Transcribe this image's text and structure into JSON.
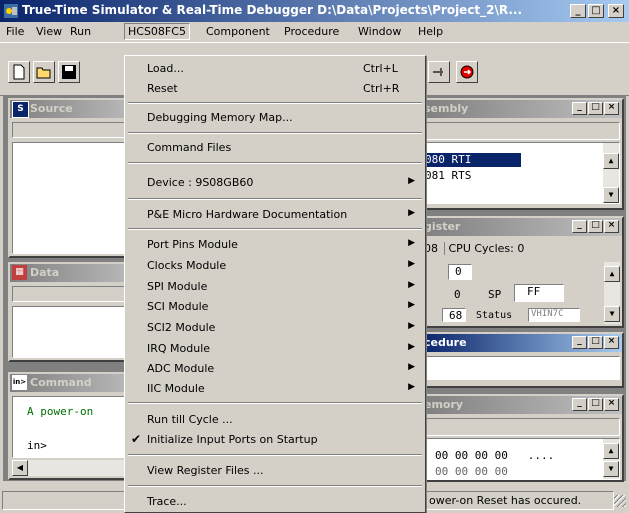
{
  "window": {
    "title": "True-Time Simulator & Real-Time Debugger  D:\\Data\\Projects\\Project_2\\R..."
  },
  "caption_buttons": {
    "minimize": "_",
    "maximize": "□",
    "close": "×"
  },
  "menubar": [
    "File",
    "View",
    "Run",
    "HCS08FC5",
    "Component",
    "Procedure",
    "Window",
    "Help"
  ],
  "toolbar": {
    "icons": [
      "new-file-icon",
      "open-folder-icon",
      "save-disk-icon",
      "step-icon",
      "reset-icon"
    ]
  },
  "panels": {
    "source": {
      "title": "Source",
      "icon": "S"
    },
    "assembly": {
      "title": "sembly",
      "lines": [
        "080 RTI",
        "081 RTS"
      ]
    },
    "register": {
      "title": "gister",
      "cpu_cycles_prefix": "08",
      "cpu_cycles_label": "CPU Cycles: 0",
      "row1": [
        "0"
      ],
      "row2_val": "0",
      "sp_label": "SP",
      "sp_val": "FF",
      "row3_val": "68",
      "status_label": "Status",
      "status_val": "VHIN7C"
    },
    "data": {
      "title": "Data"
    },
    "procedure": {
      "title": "cedure"
    },
    "command": {
      "title": "Command",
      "icon": "in>",
      "lines": [
        "A power-on",
        "",
        "in>"
      ]
    },
    "memory": {
      "title": "emory",
      "row": "00 00 00 00   ....",
      "row2": "00 00 00 00"
    }
  },
  "statusbar": {
    "message": "ower-on Reset has occured."
  },
  "dropdown": {
    "items": [
      {
        "label": "Load...",
        "shortcut": "Ctrl+L"
      },
      {
        "label": "Reset",
        "shortcut": "Ctrl+R"
      },
      {
        "label": "Debugging Memory Map..."
      },
      {
        "label": "Command Files"
      },
      {
        "label": "Device : 9S08GB60",
        "submenu": true
      },
      {
        "label": "P&E Micro Hardware Documentation",
        "submenu": true
      },
      {
        "label": "Port Pins Module",
        "submenu": true
      },
      {
        "label": "Clocks Module",
        "submenu": true
      },
      {
        "label": "SPI Module",
        "submenu": true
      },
      {
        "label": "SCI Module",
        "submenu": true
      },
      {
        "label": "SCI2 Module",
        "submenu": true
      },
      {
        "label": "IRQ Module",
        "submenu": true
      },
      {
        "label": "ADC Module",
        "submenu": true
      },
      {
        "label": "IIC Module",
        "submenu": true
      },
      {
        "label": "Run till Cycle ..."
      },
      {
        "label": "Initialize Input Ports on Startup",
        "checked": true
      },
      {
        "label": "View Register Files ..."
      },
      {
        "label": "Trace..."
      }
    ],
    "arrow": "▶",
    "check": "✔"
  },
  "colors": {
    "title_active": "#0a246a",
    "highlight": "#0a246a",
    "face": "#d4d0c8",
    "mdi": "#808080"
  }
}
